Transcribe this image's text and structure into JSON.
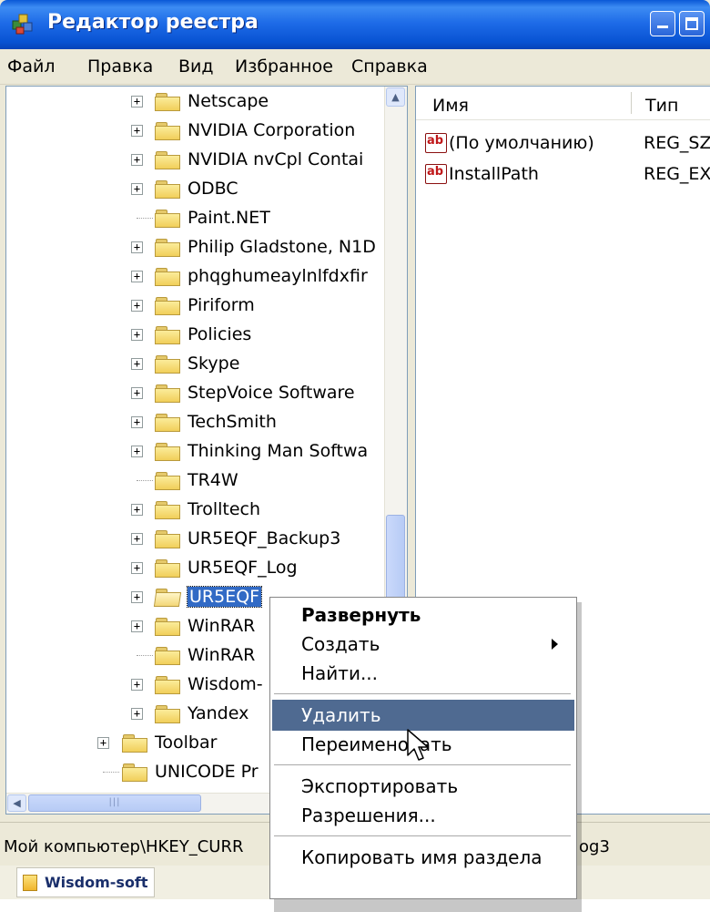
{
  "window": {
    "title": "Редактор реестра"
  },
  "menu": [
    "Файл",
    "Правка",
    "Вид",
    "Избранное",
    "Справка"
  ],
  "tree": {
    "items": [
      {
        "label": "Netscape",
        "expandable": true
      },
      {
        "label": "NVIDIA Corporation",
        "expandable": true
      },
      {
        "label": "NVIDIA nvCpl Contai",
        "expandable": true
      },
      {
        "label": "ODBC",
        "expandable": true
      },
      {
        "label": "Paint.NET",
        "expandable": false
      },
      {
        "label": "Philip Gladstone, N1D",
        "expandable": true
      },
      {
        "label": "phqghumeaylnlfdxfir",
        "expandable": true
      },
      {
        "label": "Piriform",
        "expandable": true
      },
      {
        "label": "Policies",
        "expandable": true
      },
      {
        "label": "Skype",
        "expandable": true
      },
      {
        "label": "StepVoice Software",
        "expandable": true
      },
      {
        "label": "TechSmith",
        "expandable": true
      },
      {
        "label": "Thinking Man Softwa",
        "expandable": true
      },
      {
        "label": "TR4W",
        "expandable": false
      },
      {
        "label": "Trolltech",
        "expandable": true
      },
      {
        "label": "UR5EQF_Backup3",
        "expandable": true
      },
      {
        "label": "UR5EQF_Log",
        "expandable": true
      },
      {
        "label": "UR5EQF",
        "expandable": true,
        "selected": true
      },
      {
        "label": "WinRAR",
        "expandable": true
      },
      {
        "label": "WinRAR",
        "expandable": false
      },
      {
        "label": "Wisdom-",
        "expandable": true
      },
      {
        "label": "Yandex",
        "expandable": true
      }
    ],
    "parent_items": [
      {
        "label": "Toolbar",
        "expandable": true
      },
      {
        "label": "UNICODE Pr",
        "expandable": false
      }
    ]
  },
  "list": {
    "columns": [
      "Имя",
      "Тип"
    ],
    "rows": [
      {
        "name": "(По умолчанию)",
        "type": "REG_SZ"
      },
      {
        "name": "InstallPath",
        "type": "REG_EX"
      }
    ]
  },
  "status": {
    "path": "Мой компьютер\\HKEY_CURR",
    "tail": "og3"
  },
  "taskbar": {
    "label": "Wisdom-soft"
  },
  "context_menu": {
    "items": [
      {
        "label": "Развернуть",
        "bold": true
      },
      {
        "label": "Создать",
        "submenu": true
      },
      {
        "label": "Найти..."
      },
      {
        "separator": true
      },
      {
        "label": "Удалить",
        "highlighted": true
      },
      {
        "label": "Переименовать"
      },
      {
        "separator": true
      },
      {
        "label": "Экспортировать"
      },
      {
        "label": "Разрешения..."
      },
      {
        "separator": true
      },
      {
        "label": "Копировать имя раздела"
      }
    ]
  },
  "colors": {
    "titlebar": "#0a58d6",
    "selection": "#316ac5",
    "menu_highlight": "#4f6a91"
  },
  "icons": [
    "regedit-icon",
    "minimize-icon",
    "maximize-icon",
    "folder-icon",
    "folder-open-icon",
    "expand-plus-icon",
    "string-value-icon",
    "submenu-arrow-icon",
    "mouse-cursor-icon"
  ]
}
